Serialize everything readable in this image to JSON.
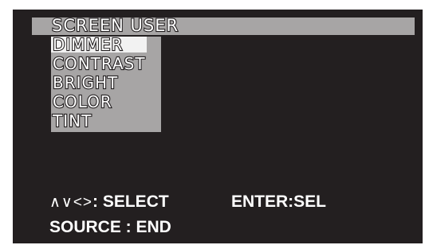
{
  "osd": {
    "title": "SCREEN USER",
    "menu_items": [
      {
        "label": "DIMMER",
        "selected": true
      },
      {
        "label": "CONTRAST",
        "selected": false
      },
      {
        "label": "BRIGHT",
        "selected": false
      },
      {
        "label": "COLOR",
        "selected": false
      },
      {
        "label": "TINT",
        "selected": false
      }
    ],
    "hint_select_arrows": "∧∨<>",
    "hint_select_label": ": SELECT",
    "hint_enter": "ENTER:SEL",
    "hint_source": "SOURCE : END"
  },
  "colors": {
    "screen_background": "#231f20",
    "menu_background": "#a7a5a5",
    "selected_background": "#f2f2f2",
    "text": "#ffffff"
  }
}
